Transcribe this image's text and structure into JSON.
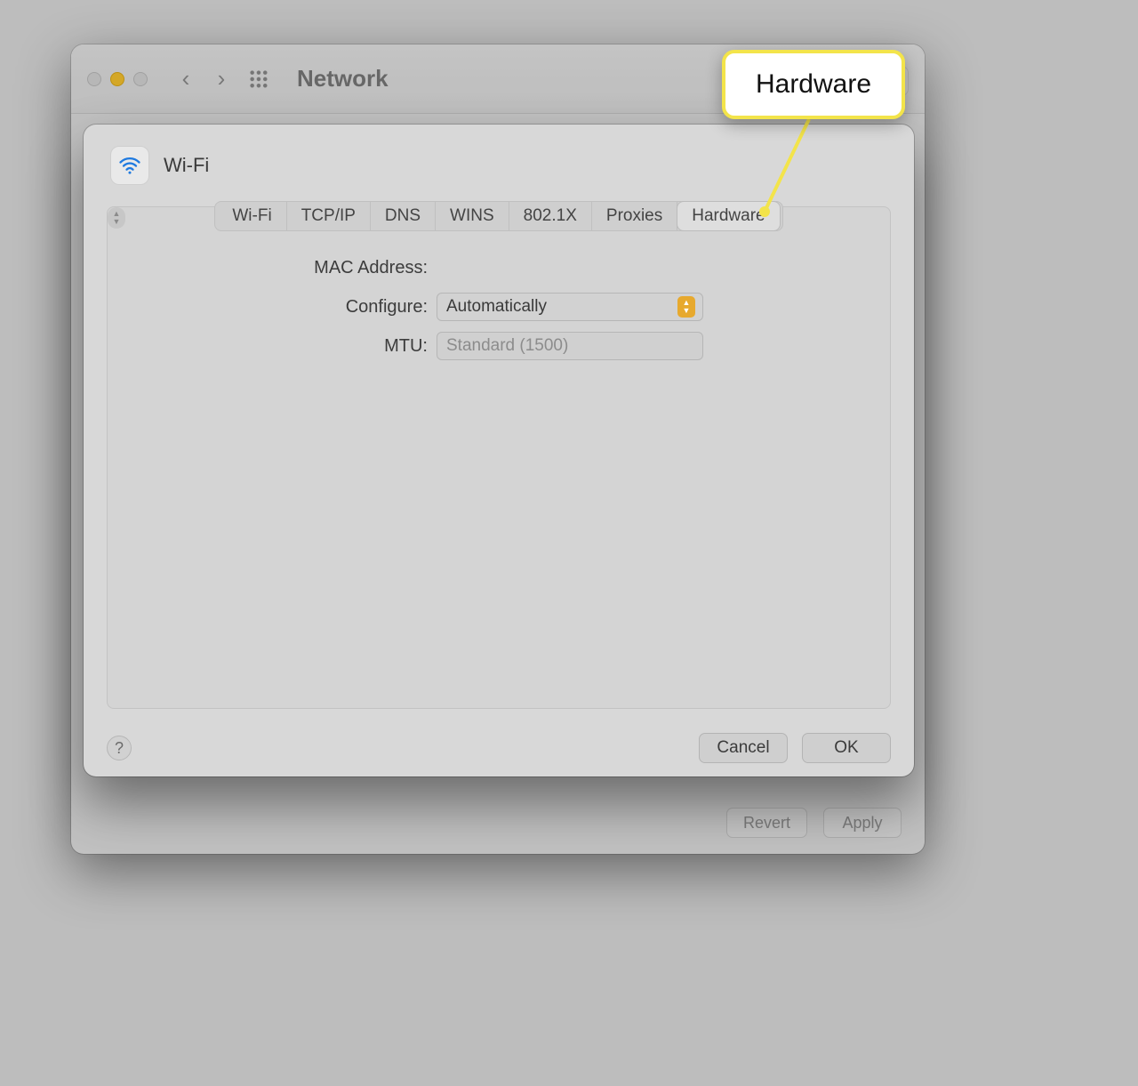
{
  "window": {
    "title": "Network",
    "footer": {
      "revert": "Revert",
      "apply": "Apply"
    }
  },
  "sheet": {
    "service_name": "Wi-Fi",
    "tabs": [
      "Wi-Fi",
      "TCP/IP",
      "DNS",
      "WINS",
      "802.1X",
      "Proxies",
      "Hardware"
    ],
    "active_tab_index": 6,
    "hardware": {
      "mac_label": "MAC Address:",
      "mac_value": "",
      "configure_label": "Configure:",
      "configure_value": "Automatically",
      "mtu_label": "MTU:",
      "mtu_value": "Standard  (1500)"
    },
    "footer": {
      "help": "?",
      "cancel": "Cancel",
      "ok": "OK"
    }
  },
  "callout": {
    "label": "Hardware"
  }
}
